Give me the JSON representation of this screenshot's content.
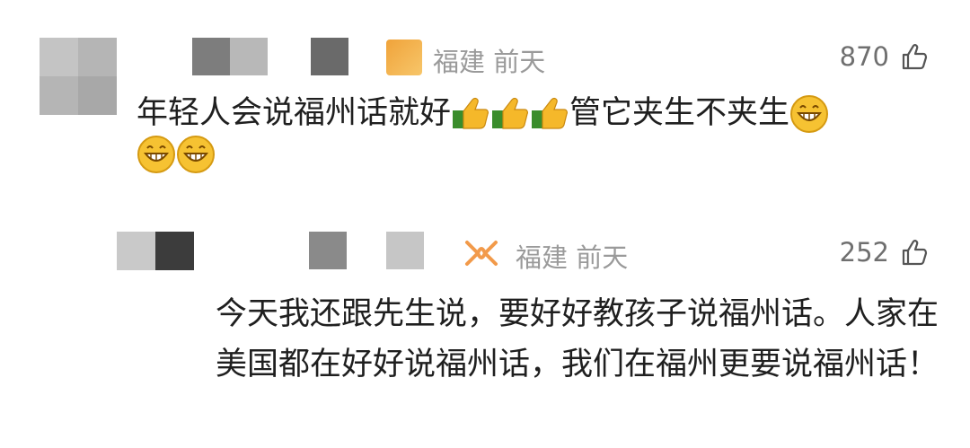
{
  "comments": [
    {
      "region_time": "福建 前天",
      "likes": "870",
      "text_before": "年轻人会说福州话就好",
      "text_after": "管它夹生不夹生",
      "emojis": [
        "thumbs-up-icon",
        "grin-icon"
      ]
    },
    {
      "region_time": "福建 前天",
      "likes": "252",
      "text": "今天我还跟先生说，要好好教孩子说福州话。人家在美国都在好好说福州话，我们在福州更要说福州话！"
    }
  ],
  "colors": {
    "thumb_body": "#f5b82a",
    "thumb_cuff": "#3a8d2c",
    "grin": "#f6c232"
  }
}
